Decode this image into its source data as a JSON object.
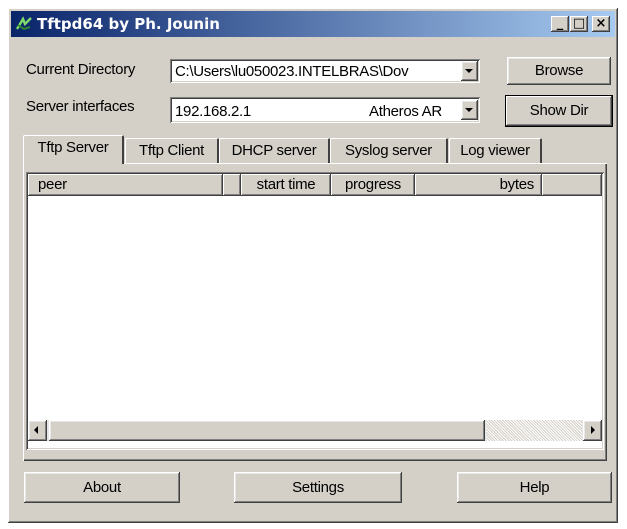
{
  "window": {
    "title": "Tftpd64 by Ph. Jounin",
    "controls": {
      "minimize": "_",
      "maximize": "□",
      "close": "×"
    }
  },
  "current_directory": {
    "label": "Current Directory",
    "value": "C:\\Users\\lu050023.INTELBRAS\\Dov",
    "browse_label": "Browse"
  },
  "server_interfaces": {
    "label": "Server interfaces",
    "ip": "192.168.2.1",
    "adapter": "Atheros AR",
    "show_dir_label": "Show Dir"
  },
  "tabs": [
    {
      "label": "Tftp Server",
      "active": true
    },
    {
      "label": "Tftp Client",
      "active": false
    },
    {
      "label": "DHCP server",
      "active": false
    },
    {
      "label": "Syslog server",
      "active": false
    },
    {
      "label": "Log viewer",
      "active": false
    }
  ],
  "table": {
    "columns": [
      "peer",
      "",
      "start time",
      "progress",
      "bytes"
    ],
    "rows": []
  },
  "buttons": {
    "about": "About",
    "settings": "Settings",
    "help": "Help"
  },
  "icons": {
    "app": "tftpd-app-icon",
    "combo_arrow": "chevron-down-icon",
    "scroll_left": "arrow-left-icon",
    "scroll_right": "arrow-right-icon"
  },
  "colors": {
    "title_gradient_start": "#0a246a",
    "title_gradient_end": "#a6caf0",
    "face": "#d4d0c8"
  }
}
